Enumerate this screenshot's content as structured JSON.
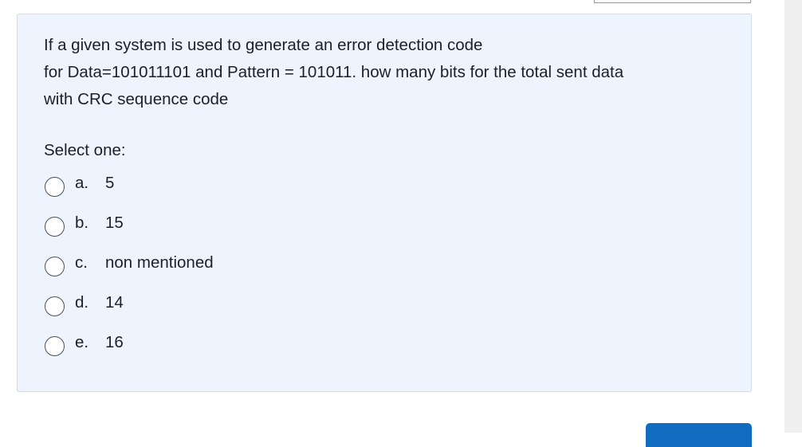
{
  "question": {
    "lines": [
      "If a given system is used to generate an error detection code",
      "for Data=101011101 and Pattern = 101011.  how many bits for the total sent data",
      "with CRC sequence code"
    ]
  },
  "prompt": "Select one:",
  "options": [
    {
      "letter": "a.",
      "text": "5",
      "selected": false
    },
    {
      "letter": "b.",
      "text": "15",
      "selected": false
    },
    {
      "letter": "c.",
      "text": "non mentioned",
      "selected": false
    },
    {
      "letter": "d.",
      "text": "14",
      "selected": false
    },
    {
      "letter": "e.",
      "text": "16",
      "selected": false
    }
  ],
  "colors": {
    "card_background": "#edf4fd",
    "card_border": "#cfdcec",
    "primary_button": "#0f6cbf",
    "text": "#1d2125"
  }
}
